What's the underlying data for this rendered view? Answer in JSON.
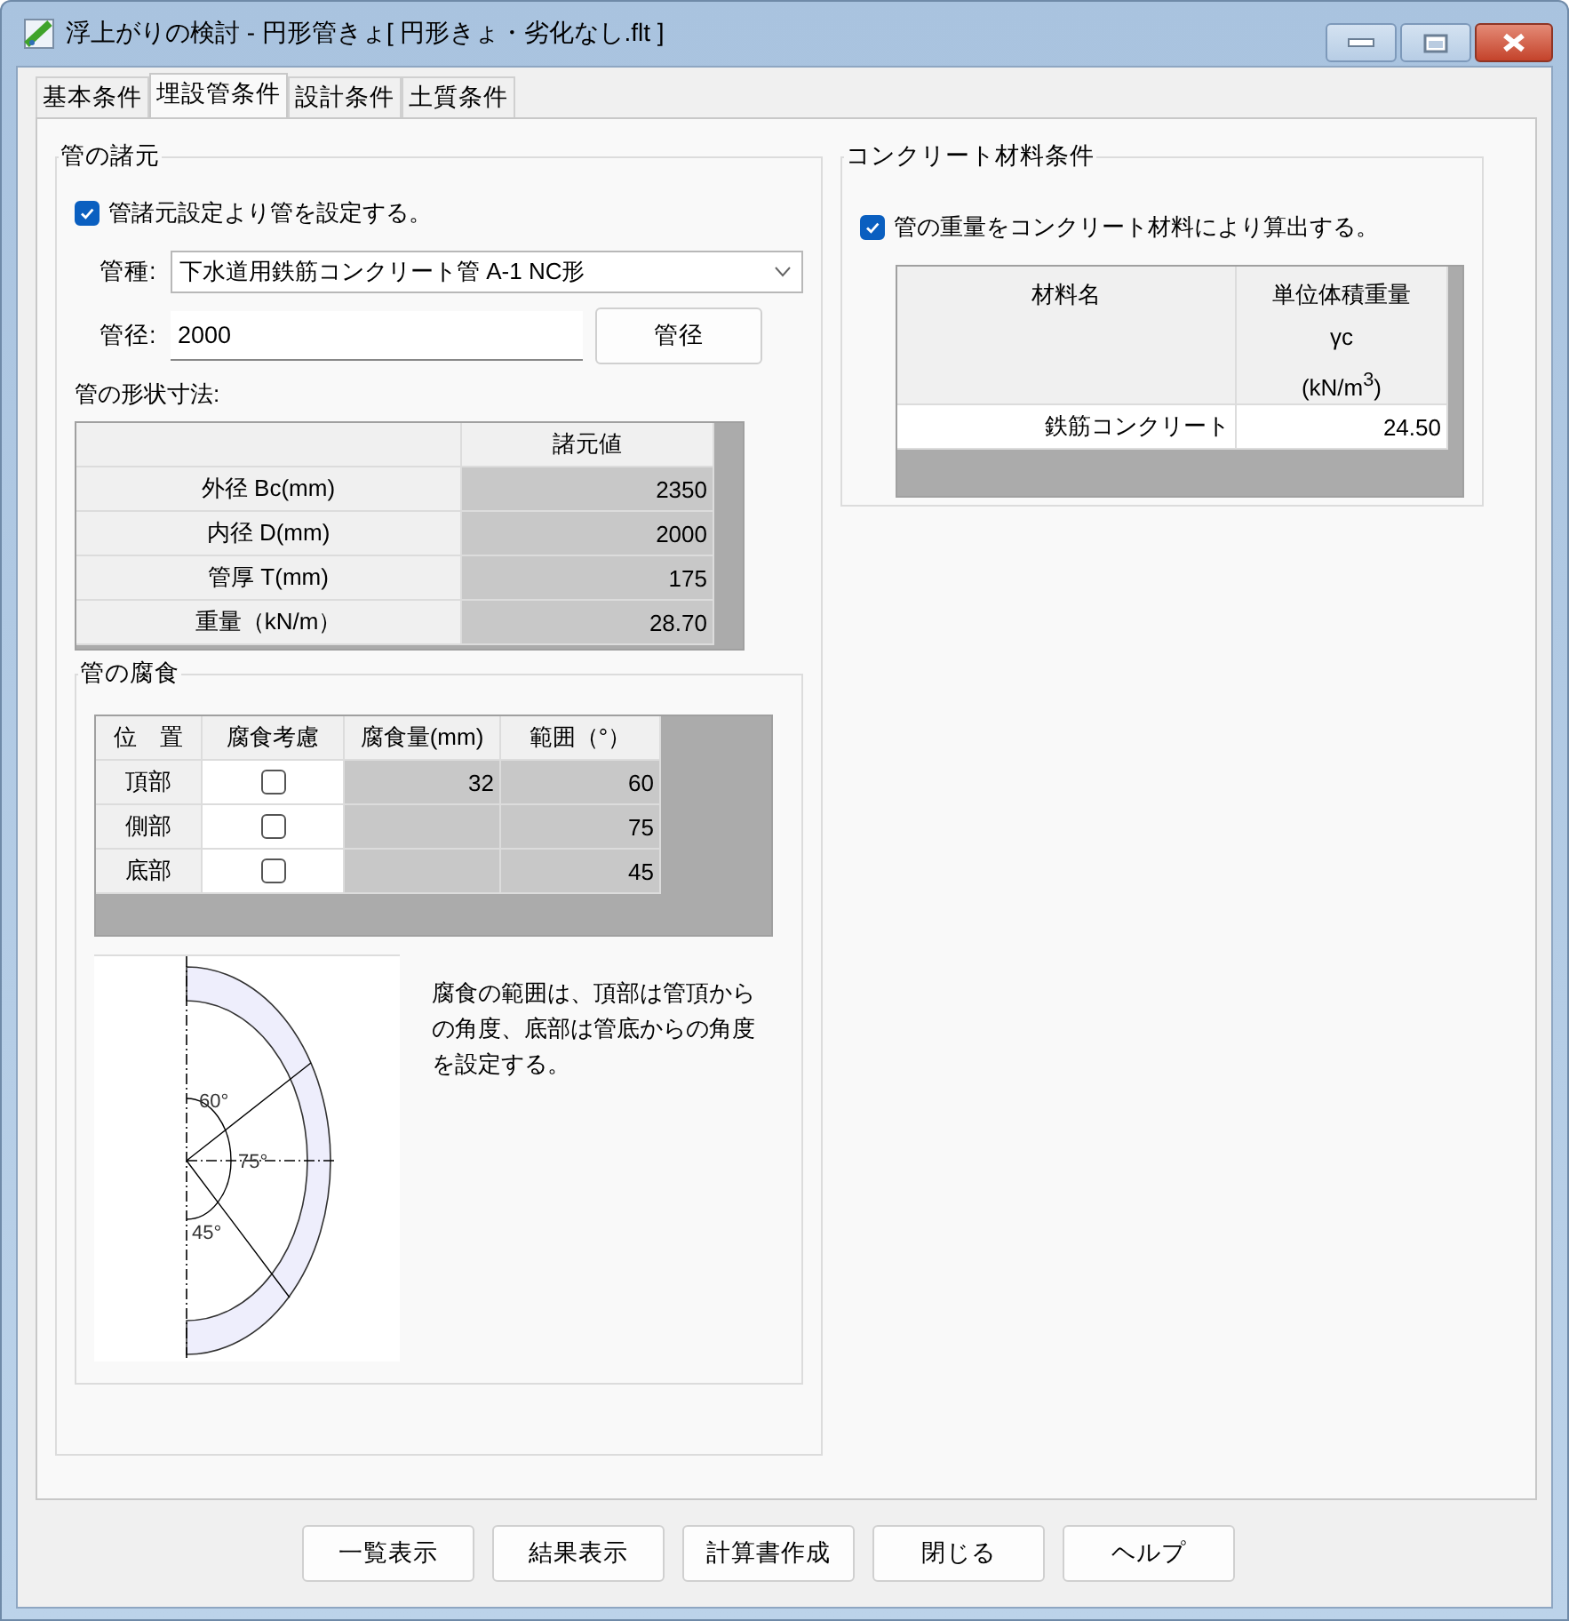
{
  "window": {
    "title": "浮上がりの検討 - 円形管きょ[ 円形きょ・劣化なし.flt ]"
  },
  "tabs": [
    {
      "label": "基本条件",
      "selected": false
    },
    {
      "label": "埋設管条件",
      "selected": true
    },
    {
      "label": "設計条件",
      "selected": false
    },
    {
      "label": "土質条件",
      "selected": false
    }
  ],
  "pipe_specs": {
    "title": "管の諸元",
    "checkbox": {
      "label": "管諸元設定より管を設定する。",
      "checked": true
    },
    "pipe_type": {
      "label": "管種:",
      "value": "下水道用鉄筋コンクリート管 A-1 NC形"
    },
    "diameter": {
      "label": "管径:",
      "value": "2000",
      "button": "管径"
    },
    "shape_label": "管の形状寸法:",
    "table": {
      "header": "諸元値",
      "rows": [
        {
          "label": "外径 Bc(mm)",
          "value": "2350"
        },
        {
          "label": "内径 D(mm)",
          "value": "2000"
        },
        {
          "label": "管厚 T(mm)",
          "value": "175"
        },
        {
          "label": "重量（kN/m）",
          "value": "28.70"
        }
      ]
    }
  },
  "corrosion": {
    "title": "管の腐食",
    "columns": [
      "位　置",
      "腐食考慮",
      "腐食量(mm)",
      "範囲（°）"
    ],
    "rows": [
      {
        "position": "頂部",
        "considered": false,
        "amount": "32",
        "range": "60"
      },
      {
        "position": "側部",
        "considered": false,
        "range": "75"
      },
      {
        "position": "底部",
        "considered": false,
        "range": "45"
      }
    ],
    "diagram_labels": [
      "60°",
      "75°",
      "45°"
    ],
    "note": "腐食の範囲は、頂部は管頂からの角度、底部は管底からの角度を設定する。"
  },
  "concrete": {
    "title": "コンクリート材料条件",
    "checkbox": {
      "label": "管の重量をコンクリート材料により算出する。",
      "checked": true
    },
    "columns": [
      [
        "材料名"
      ],
      [
        "単位体積重量",
        "γc",
        "(kN/m$^{3}$)"
      ]
    ],
    "rows": [
      {
        "name": "鉄筋コンクリート",
        "weight": "24.50"
      }
    ]
  },
  "buttons": [
    "一覧表示",
    "結果表示",
    "計算書作成",
    "閉じる",
    "ヘルプ"
  ]
}
